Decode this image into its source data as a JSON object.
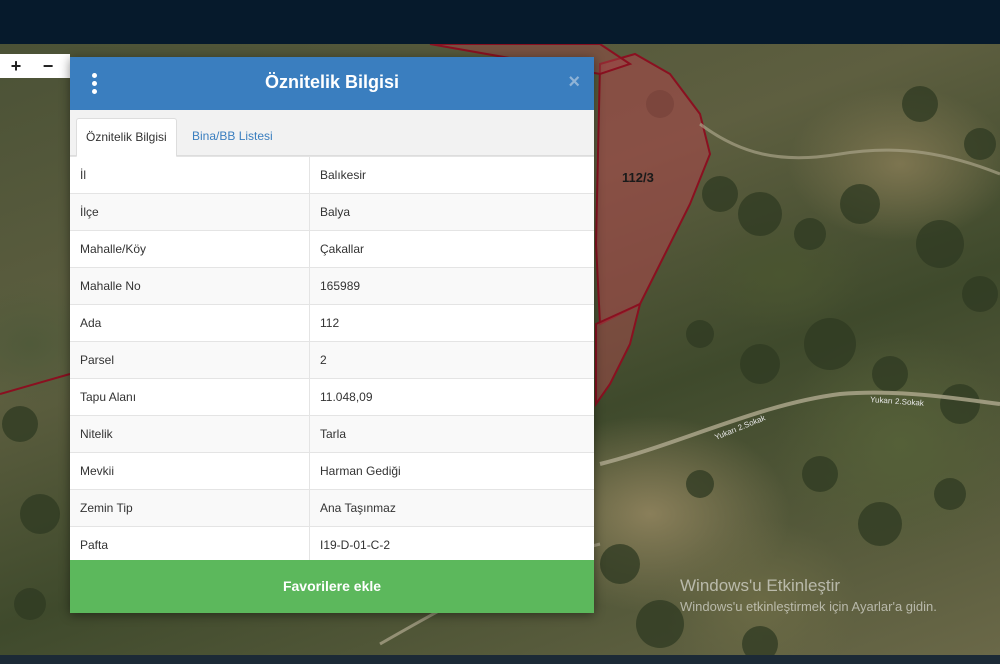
{
  "map": {
    "zoom_in": "+",
    "zoom_out": "−",
    "parcel_label": "112/3",
    "road_label_1": "Yukarı 2.Sokak",
    "road_label_2": "Yukarı 2.Sokak"
  },
  "dialog": {
    "title": "Öznitelik Bilgisi",
    "close": "×",
    "tabs": [
      "Öznitelik Bilgisi",
      "Bina/BB Listesi"
    ],
    "rows": [
      {
        "key": "İl",
        "value": "Balıkesir"
      },
      {
        "key": "İlçe",
        "value": "Balya"
      },
      {
        "key": "Mahalle/Köy",
        "value": "Çakallar"
      },
      {
        "key": "Mahalle No",
        "value": "165989"
      },
      {
        "key": "Ada",
        "value": "112"
      },
      {
        "key": "Parsel",
        "value": "2"
      },
      {
        "key": "Tapu Alanı",
        "value": "11.048,09"
      },
      {
        "key": "Nitelik",
        "value": "Tarla"
      },
      {
        "key": "Mevkii",
        "value": "Harman Gediği"
      },
      {
        "key": "Zemin Tip",
        "value": "Ana Taşınmaz"
      },
      {
        "key": "Pafta",
        "value": "I19-D-01-C-2"
      }
    ],
    "favorite_button": "Favorilere ekle"
  },
  "watermark": {
    "line1": "Windows'u Etkinleştir",
    "line2": "Windows'u etkinleştirmek için Ayarlar'a gidin."
  },
  "colors": {
    "header": "#3a7ebf",
    "favorite": "#5cb85c",
    "parcel_fill": "#a04848",
    "parcel_stroke": "#8a1020"
  }
}
